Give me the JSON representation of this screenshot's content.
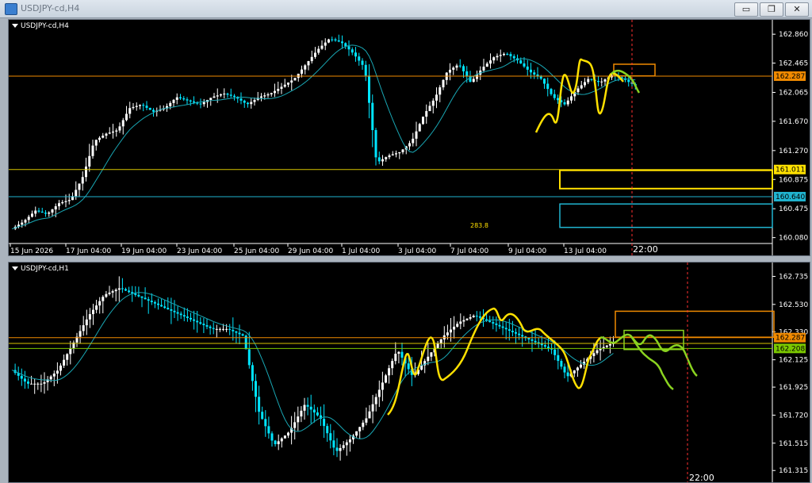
{
  "window": {
    "title": "USDJPY-cd,H4",
    "buttons": {
      "minimize": "▭",
      "restore": "❐",
      "close": "✕"
    }
  },
  "colors": {
    "bull": "#ffffff",
    "bear": "#00e5ff",
    "ma": "#19a7b4",
    "yellow_line": "#ffe000",
    "green_line": "#8ad320",
    "orange_box": "#f08a00",
    "yellow_level": "#d8c400",
    "cyan_level": "#20b4d0",
    "green_level": "#7bc800",
    "vline": "#ff3030"
  },
  "chart_data": [
    {
      "type": "candlestick",
      "label": "USDJPY-cd,H4",
      "ylim": [
        160.0,
        162.97
      ],
      "yticks": [
        "162.860",
        "162.465",
        "162.065",
        "161.670",
        "161.270",
        "160.875",
        "160.475",
        "160.080"
      ],
      "xticks": [
        "15 Jun 2026",
        "17 Jun 04:00",
        "19 Jun 04:00",
        "23 Jun 04:00",
        "25 Jun 04:00",
        "29 Jun 04:00",
        "1 Jul 04:00",
        "3 Jul 04:00",
        "7 Jul 04:00",
        "9 Jul 04:00",
        "13 Jul 04:00"
      ],
      "price_labels": [
        {
          "value": 162.287,
          "text": "162.287",
          "role": "orange"
        },
        {
          "value": 161.011,
          "text": "161.011",
          "role": "yellow"
        },
        {
          "value": 160.64,
          "text": "160.640",
          "role": "cyan"
        }
      ],
      "time_marker": "22:00",
      "inline_text": "283.8"
    },
    {
      "type": "candlestick",
      "label": "USDJPY-cd,H1",
      "ylim": [
        161.27,
        162.79
      ],
      "yticks": [
        "162.735",
        "162.530",
        "162.330",
        "162.125",
        "161.925",
        "161.720",
        "161.515",
        "161.315"
      ],
      "price_labels": [
        {
          "value": 162.287,
          "text": "162.287",
          "role": "orange"
        },
        {
          "value": 162.208,
          "text": "162.208",
          "role": "green"
        }
      ],
      "time_marker": "22:00"
    }
  ]
}
